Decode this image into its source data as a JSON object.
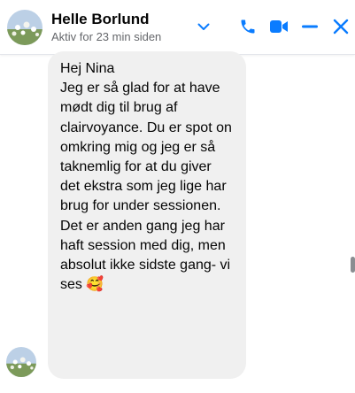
{
  "contact": {
    "name": "Helle Borlund",
    "status": "Aktiv for 23 min siden"
  },
  "icons": {
    "chevron": "chevron-down-icon",
    "call": "phone-icon",
    "video": "video-camera-icon",
    "minimize": "minimize-icon",
    "close": "close-icon"
  },
  "colors": {
    "accent": "#0a7cff",
    "bubble": "#f0f0f0",
    "muted_text": "#65676b"
  },
  "message": {
    "text": "Hej Nina\nJeg er så glad for at have mødt dig til brug af clairvoyance. Du er spot on omkring mig og jeg er så taknemlig for at du giver det ekstra som jeg lige har brug for under sessionen.\nDet er anden gang jeg har haft session med dig, men absolut ikke sidste gang- vi ses 🥰"
  }
}
